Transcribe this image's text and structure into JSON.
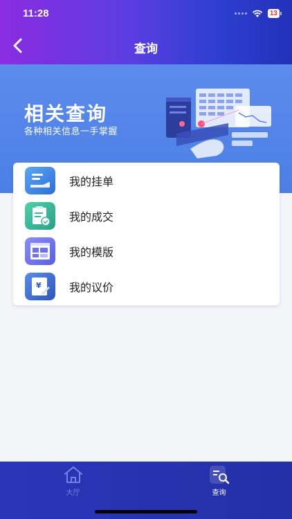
{
  "status_bar": {
    "time": "11:28",
    "battery": "13"
  },
  "header": {
    "title": "查询"
  },
  "banner": {
    "title": "相关查询",
    "subtitle": "各种相关信息一手掌握"
  },
  "menu": {
    "items": [
      {
        "label": "我的挂单",
        "icon": "pending-order-icon"
      },
      {
        "label": "我的成交",
        "icon": "deal-clipboard-icon"
      },
      {
        "label": "我的模版",
        "icon": "template-grid-icon"
      },
      {
        "label": "我的议价",
        "icon": "bargain-price-icon"
      }
    ]
  },
  "tabbar": {
    "items": [
      {
        "label": "大厅",
        "icon": "home-icon",
        "active": false
      },
      {
        "label": "查询",
        "icon": "query-search-icon",
        "active": true
      }
    ]
  },
  "colors": {
    "header_start": "#8b2ce0",
    "header_end": "#2331b8",
    "banner": "#5b8cec",
    "tabbar": "#2a36b8",
    "tab_active": "#ffffff",
    "tab_inactive": "#6f86e8"
  }
}
